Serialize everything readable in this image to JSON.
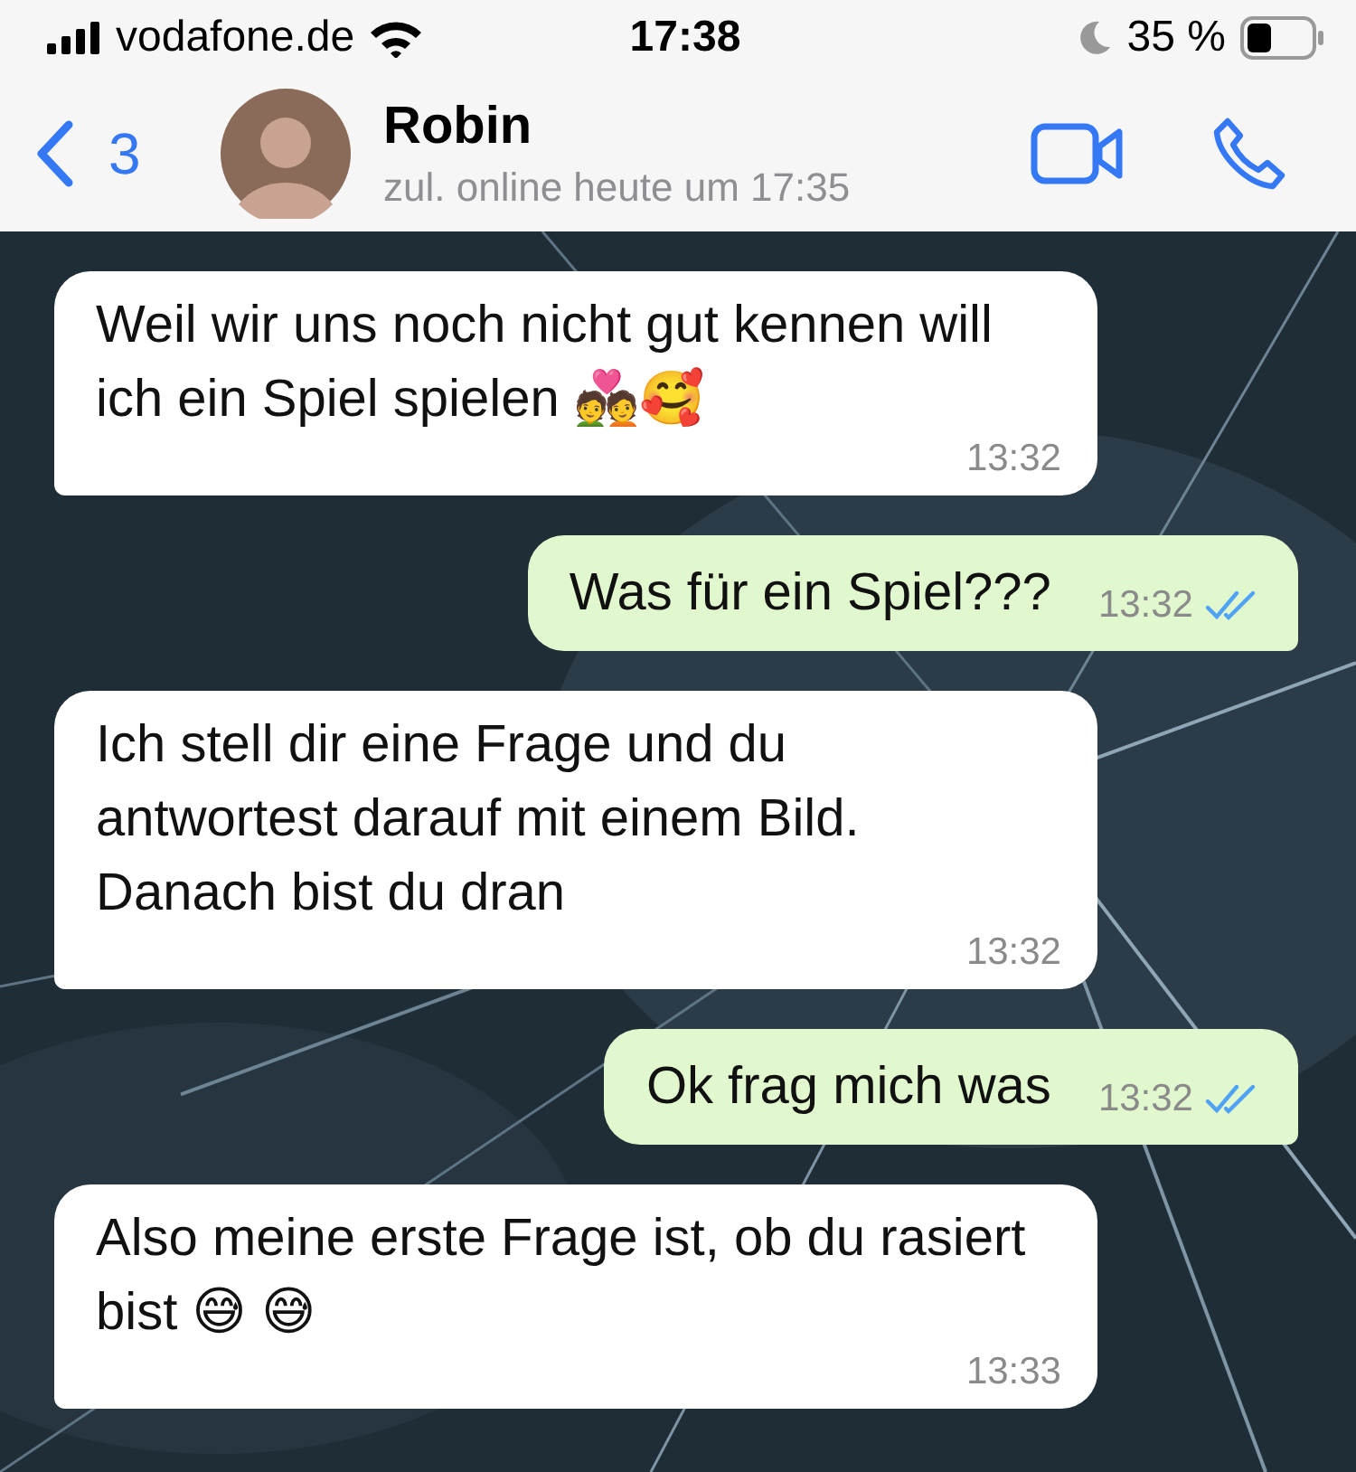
{
  "status_bar": {
    "carrier": "vodafone.de",
    "time": "17:38",
    "battery": "35 %"
  },
  "header": {
    "back_count": "3",
    "name": "Robin",
    "subtitle": "zul. online heute um 17:35"
  },
  "messages": [
    {
      "kind": "incoming",
      "text": "Weil wir uns noch nicht gut kennen will ich ein Spiel spielen 💑🥰",
      "time": "13:32"
    },
    {
      "kind": "outgoing",
      "text": "Was für ein Spiel???",
      "time": "13:32",
      "read": true
    },
    {
      "kind": "incoming",
      "text": "Ich stell dir eine Frage und du antwortest darauf mit einem Bild. Danach bist du dran",
      "time": "13:32"
    },
    {
      "kind": "outgoing",
      "text": "Ok frag mich was",
      "time": "13:32",
      "read": true
    },
    {
      "kind": "incoming",
      "text": "Also meine erste Frage ist, ob du rasiert bist 😅 😅",
      "time": "13:33"
    }
  ]
}
